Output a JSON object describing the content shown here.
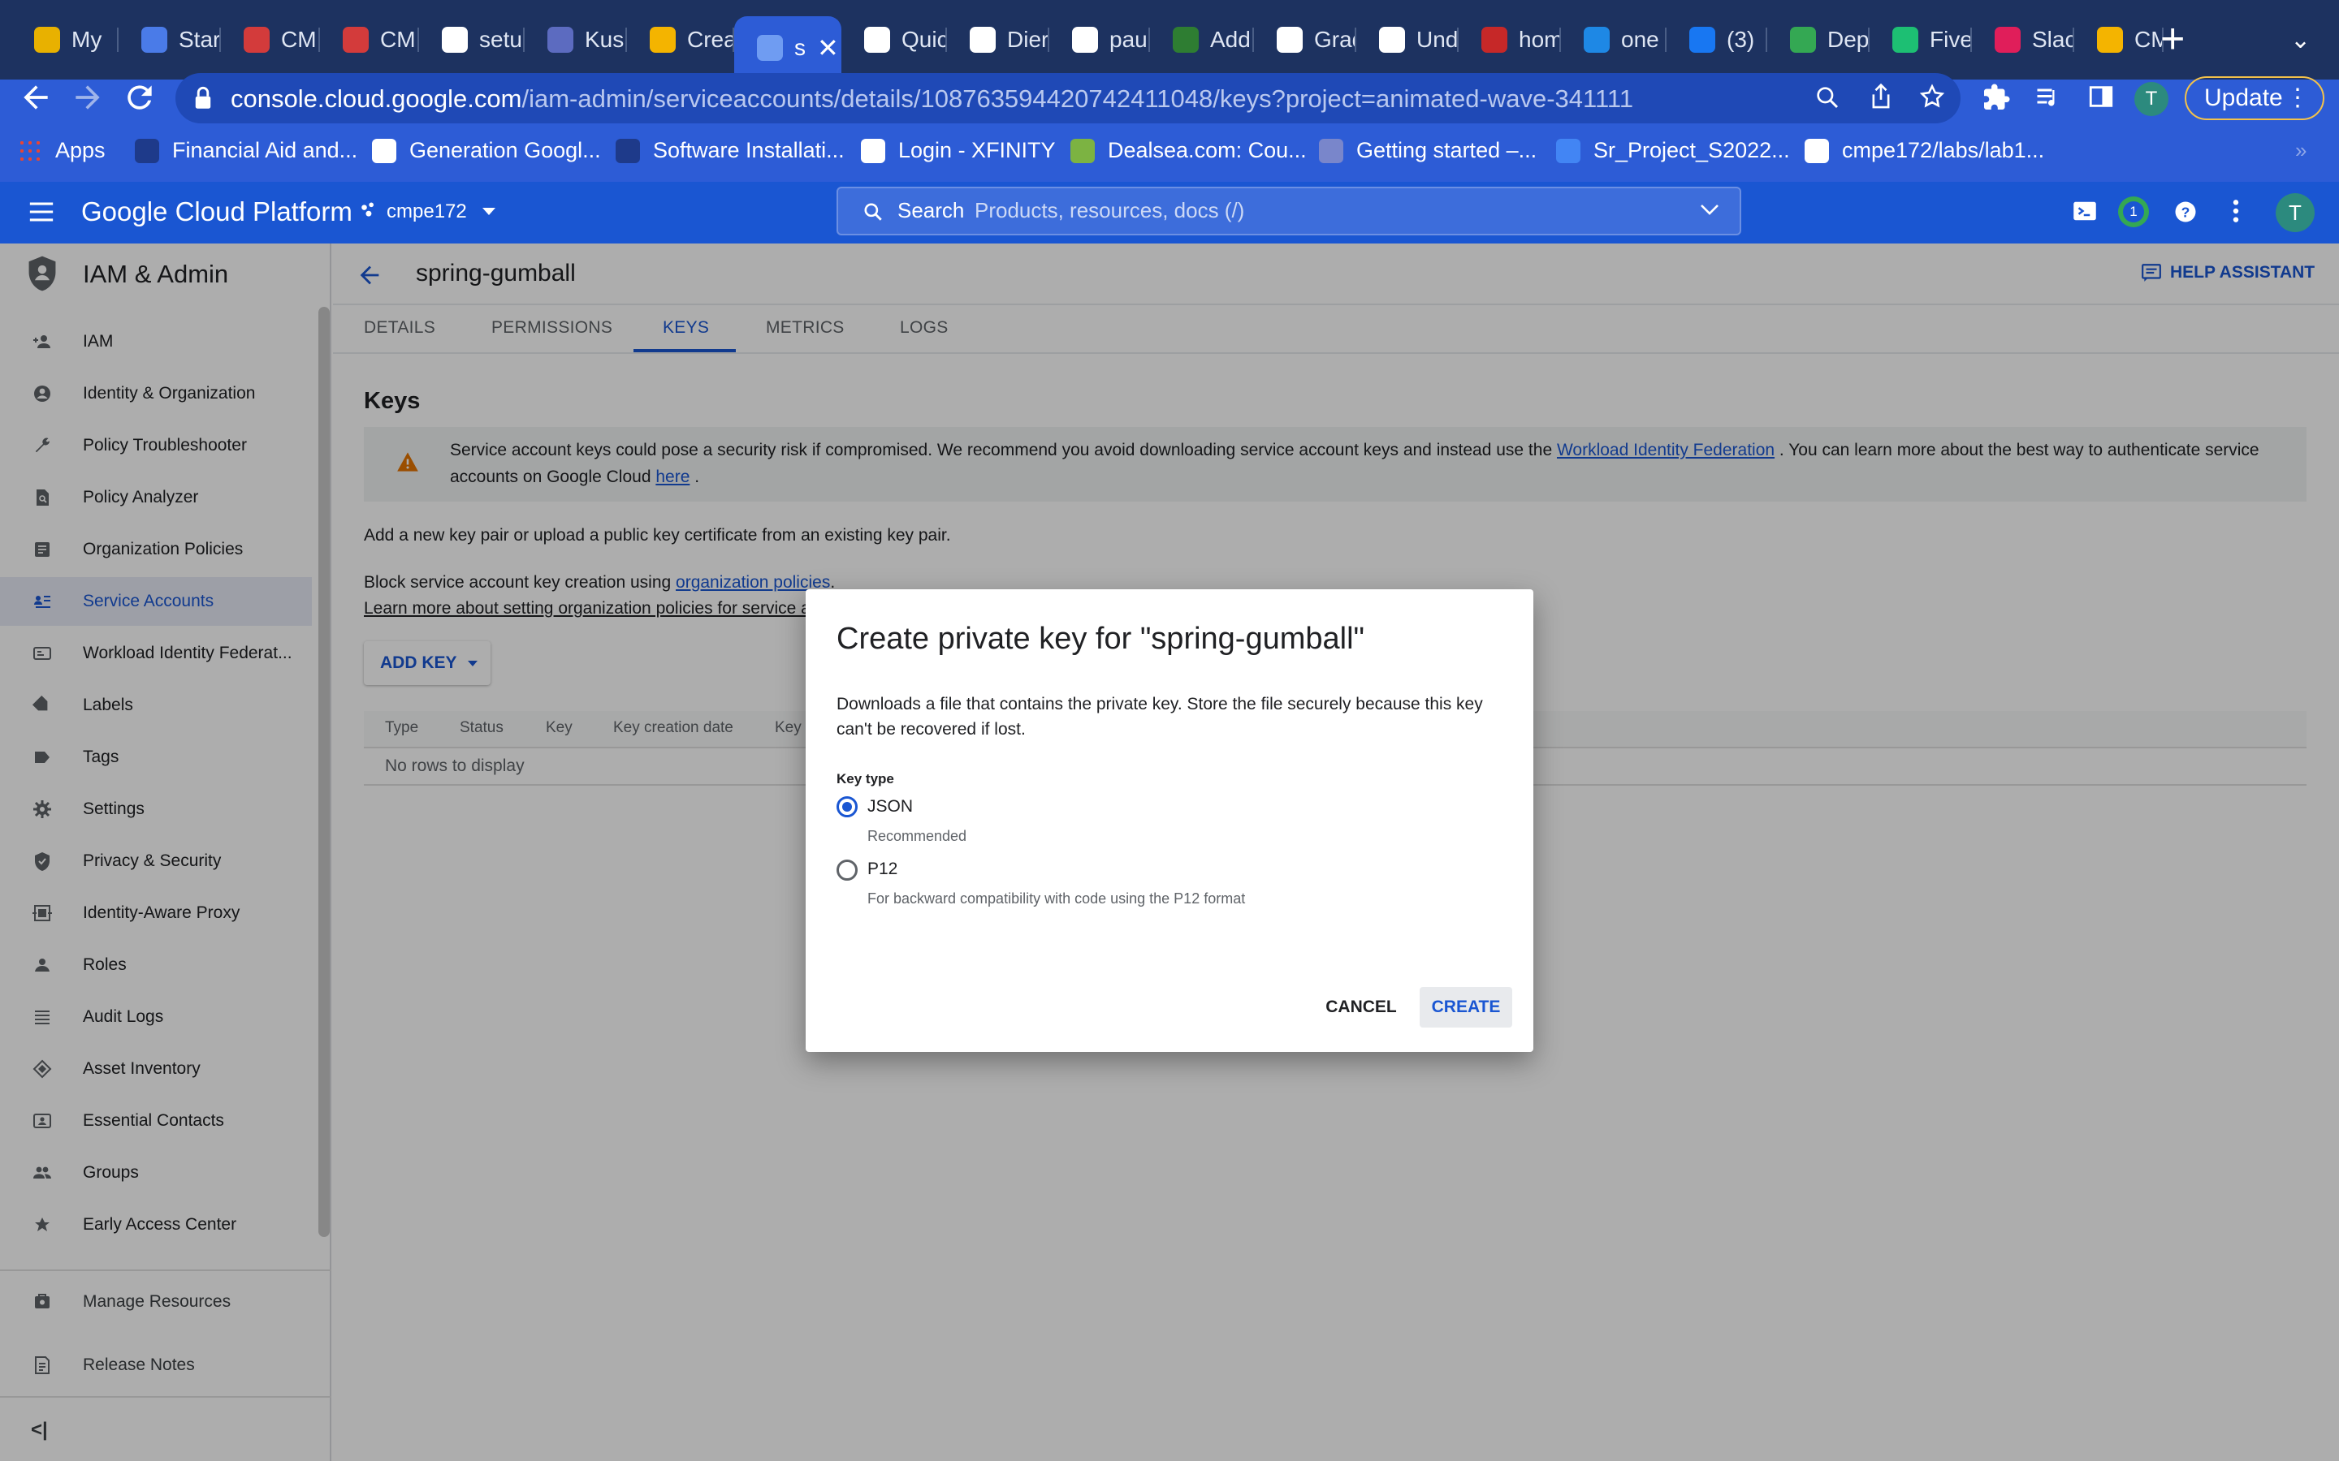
{
  "browser": {
    "tabs": [
      {
        "label": "My",
        "color": "#e8b100"
      },
      {
        "label": "Star",
        "color": "#4a7be8"
      },
      {
        "label": "CMI",
        "color": "#d33b3b"
      },
      {
        "label": "CMI",
        "color": "#d33b3b"
      },
      {
        "label": "setu",
        "color": "#ffffff"
      },
      {
        "label": "Kus",
        "color": "#5c6bc0"
      },
      {
        "label": "Crea",
        "color": "#f4b400"
      },
      {
        "label": "s",
        "color": "#6f9cf2"
      },
      {
        "label": "Quic",
        "color": "#ffffff"
      },
      {
        "label": "Dier",
        "color": "#ffffff"
      },
      {
        "label": "pau",
        "color": "#ffffff"
      },
      {
        "label": "Add",
        "color": "#2e7d32"
      },
      {
        "label": "Grad",
        "color": "#ffffff"
      },
      {
        "label": "Und",
        "color": "#ffffff"
      },
      {
        "label": "hom",
        "color": "#c62828"
      },
      {
        "label": "one",
        "color": "#1e88e5"
      },
      {
        "label": "(3)",
        "color": "#1877f2"
      },
      {
        "label": "Dep",
        "color": "#34a853"
      },
      {
        "label": "Five",
        "color": "#1dbf73"
      },
      {
        "label": "Slac",
        "color": "#e01e5a"
      },
      {
        "label": "CMI",
        "color": "#f4b400"
      }
    ],
    "active_tab_close": "✕",
    "new_tab": "+",
    "url_host": "console.cloud.google.com",
    "url_path": "/iam-admin/serviceaccounts/details/108763594420742411048/keys?project=animated-wave-341111",
    "update_label": "Update",
    "profile_initial": "T",
    "bookmarks": [
      {
        "label": "Apps",
        "color": "#ea4335"
      },
      {
        "label": "Financial Aid and...",
        "color": "#1e3a8a"
      },
      {
        "label": "Generation Googl...",
        "color": "#ffffff"
      },
      {
        "label": "Software Installati...",
        "color": "#1e3a8a"
      },
      {
        "label": "Login - XFINITY",
        "color": "#ffffff"
      },
      {
        "label": "Dealsea.com: Cou...",
        "color": "#7cb342"
      },
      {
        "label": "Getting started –...",
        "color": "#7986cb"
      },
      {
        "label": "Sr_Project_S2022...",
        "color": "#4285f4"
      },
      {
        "label": "cmpe172/labs/lab1...",
        "color": "#ffffff"
      }
    ]
  },
  "gcp": {
    "title": "Google Cloud Platform",
    "project": "cmpe172",
    "search_label": "Search",
    "search_placeholder": "Products, resources, docs (/)",
    "notification_count": "1",
    "avatar_initial": "T"
  },
  "sidebar": {
    "section_title": "IAM & Admin",
    "items": [
      {
        "label": "IAM",
        "icon": "add-person-icon"
      },
      {
        "label": "Identity & Organization",
        "icon": "account-circle-icon"
      },
      {
        "label": "Policy Troubleshooter",
        "icon": "wrench-icon"
      },
      {
        "label": "Policy Analyzer",
        "icon": "document-search-icon"
      },
      {
        "label": "Organization Policies",
        "icon": "list-document-icon"
      },
      {
        "label": "Service Accounts",
        "icon": "service-account-icon",
        "active": true
      },
      {
        "label": "Workload Identity Federat...",
        "icon": "id-card-icon"
      },
      {
        "label": "Labels",
        "icon": "label-icon"
      },
      {
        "label": "Tags",
        "icon": "tag-icon"
      },
      {
        "label": "Settings",
        "icon": "gear-icon"
      },
      {
        "label": "Privacy & Security",
        "icon": "shield-icon"
      },
      {
        "label": "Identity-Aware Proxy",
        "icon": "proxy-icon"
      },
      {
        "label": "Roles",
        "icon": "roles-icon"
      },
      {
        "label": "Audit Logs",
        "icon": "list-icon"
      },
      {
        "label": "Asset Inventory",
        "icon": "diamond-icon"
      },
      {
        "label": "Essential Contacts",
        "icon": "contact-card-icon"
      },
      {
        "label": "Groups",
        "icon": "group-icon"
      },
      {
        "label": "Early Access Center",
        "icon": "early-access-icon"
      }
    ],
    "bottom_items": [
      {
        "label": "Manage Resources",
        "icon": "manage-resources-icon"
      },
      {
        "label": "Release Notes",
        "icon": "release-notes-icon"
      }
    ],
    "collapse_label": "<|"
  },
  "page": {
    "title": "spring-gumball",
    "help_assistant": "HELP ASSISTANT",
    "tabs": [
      "DETAILS",
      "PERMISSIONS",
      "KEYS",
      "METRICS",
      "LOGS"
    ],
    "active_tab": "KEYS",
    "keys_heading": "Keys",
    "warning_text_1": "Service account keys could pose a security risk if compromised. We recommend you avoid downloading service account keys and instead use the",
    "warning_link_1": "Workload Identity Federation",
    "warning_text_2": ". You can learn more about the best way to authenticate service accounts on Google Cloud",
    "warning_link_2": "here",
    "warning_text_3": ".",
    "add_key_text": "Add a new key pair or upload a public key certificate from an existing key pair.",
    "block_text": "Block service account key creation using",
    "block_link": "organization policies",
    "block_end": ".",
    "learn_more_link": "Learn more about setting organization policies for service a",
    "add_key_button": "ADD KEY",
    "table_headers": [
      "Type",
      "Status",
      "Key",
      "Key creation date",
      "Key"
    ],
    "no_rows": "No rows to display"
  },
  "dialog": {
    "title": "Create private key for \"spring-gumball\"",
    "description": "Downloads a file that contains the private key. Store the file securely because this key can't be recovered if lost.",
    "key_type_label": "Key type",
    "options": [
      {
        "label": "JSON",
        "hint": "Recommended",
        "checked": true
      },
      {
        "label": "P12",
        "hint": "For backward compatibility with code using the P12 format",
        "checked": false
      }
    ],
    "cancel": "CANCEL",
    "create": "CREATE"
  },
  "colors": {
    "tabstrip": "#1d3260",
    "chrome": "#2d5cd6",
    "gcp_header": "#1a56d2",
    "accent": "#1a56d2",
    "warning": "#e37400"
  }
}
